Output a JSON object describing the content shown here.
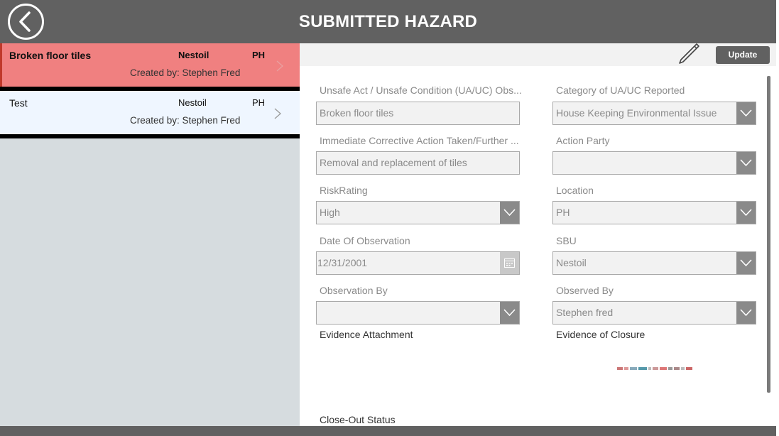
{
  "header": {
    "title": "SUBMITTED HAZARD"
  },
  "list": {
    "items": [
      {
        "title": "Broken floor tiles",
        "company": "Nestoil",
        "location": "PH",
        "created": "Created by: Stephen Fred",
        "selected": true
      },
      {
        "title": "Test",
        "company": "Nestoil",
        "location": "PH",
        "created": "Created by: Stephen Fred",
        "selected": false
      }
    ]
  },
  "toolbar": {
    "update_label": "Update"
  },
  "form": {
    "observation_label": "Unsafe Act / Unsafe Condition (UA/UC) Obs...",
    "observation_value": "Broken floor tiles",
    "category_label": "Category of UA/UC Reported",
    "category_value": "House Keeping   Environmental Issue",
    "corrective_label": "Immediate Corrective Action Taken/Further ...",
    "corrective_value": "Removal and replacement of tiles",
    "action_party_label": "Action Party",
    "action_party_value": "",
    "risk_label": "RiskRating",
    "risk_value": "High",
    "location_label": "Location",
    "location_value": "PH",
    "date_label": "Date Of Observation",
    "date_value": "12/31/2001",
    "sbu_label": "SBU",
    "sbu_value": "Nestoil",
    "observation_by_label": "Observation By",
    "observation_by_value": "",
    "observed_by_label": "Observed By",
    "observed_by_value": "Stephen fred",
    "evidence_attachment_label": "Evidence Attachment",
    "evidence_closure_label": "Evidence of Closure",
    "closeout_label": "Close-Out Status"
  },
  "colors": {
    "header": "#616161",
    "selected_row": "#f08080",
    "list_bg": "#d6dcdf",
    "row_bg": "#eff6ff"
  }
}
